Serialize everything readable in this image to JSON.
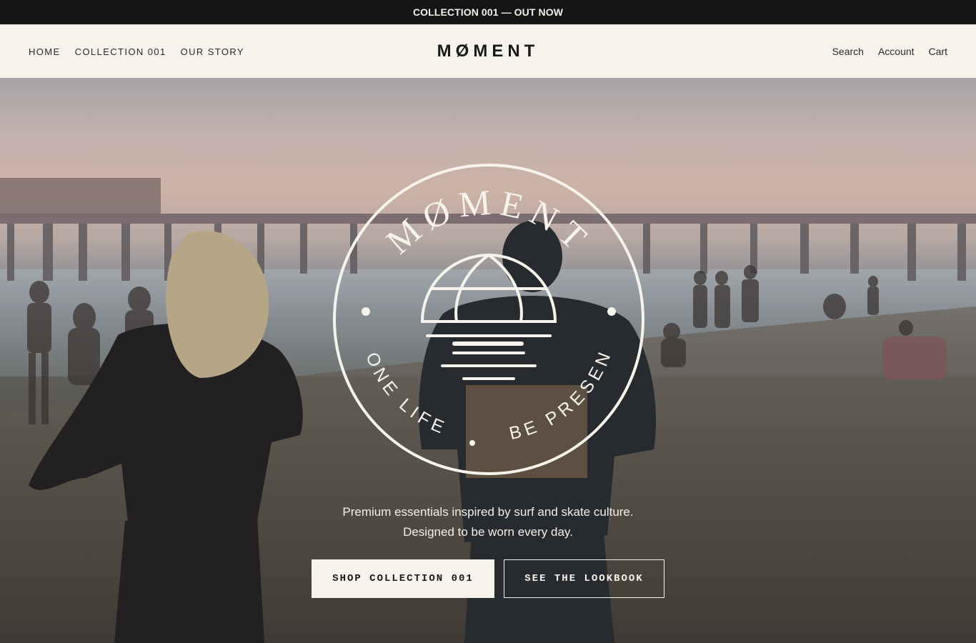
{
  "announcement": {
    "text": "COLLECTION 001 — OUT NOW"
  },
  "header": {
    "nav_left": [
      {
        "label": "HOME"
      },
      {
        "label": "COLLECTION 001"
      },
      {
        "label": "OUR STORY"
      }
    ],
    "brand": "MØMENT",
    "nav_right": [
      {
        "label": "Search"
      },
      {
        "label": "Account"
      },
      {
        "label": "Cart"
      }
    ]
  },
  "hero": {
    "badge": {
      "top_text": "MØMENT",
      "bottom_left_text": "ONE LIFE",
      "bottom_right_text": "BE PRESENT"
    },
    "tagline_line1": "Premium essentials inspired by surf and skate culture.",
    "tagline_line2": "Designed to be worn every day.",
    "primary_button": "SHOP COLLECTION 001",
    "secondary_button": "SEE THE LOOKBOOK"
  },
  "colors": {
    "announcement_bg": "#151515",
    "header_bg": "#f5f3ec",
    "text_dark": "#1a1a1a",
    "text_light": "#f5f3ec"
  }
}
